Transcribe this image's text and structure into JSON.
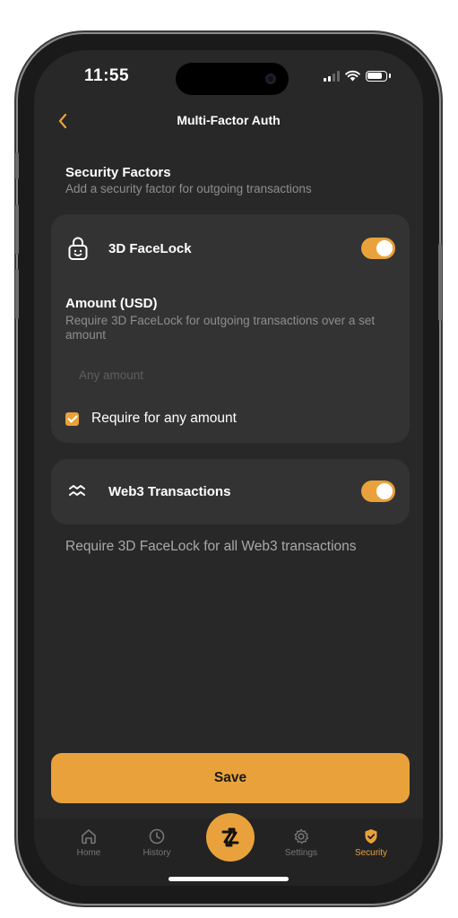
{
  "status_bar": {
    "time": "11:55"
  },
  "header": {
    "back_icon": "chevron-left-icon",
    "title": "Multi-Factor Auth"
  },
  "security_factors": {
    "title": "Security Factors",
    "subtitle": "Add a security factor for outgoing transactions"
  },
  "facelock": {
    "icon": "face-lock-icon",
    "title": "3D FaceLock",
    "enabled": true,
    "amount_title": "Amount (USD)",
    "amount_description": "Require 3D FaceLock for outgoing transactions over a set amount",
    "amount_placeholder": "Any amount",
    "amount_value": "",
    "any_amount_label": "Require for any amount",
    "any_amount_checked": true
  },
  "web3": {
    "icon": "web3-wave-icon",
    "title": "Web3 Transactions",
    "enabled": true,
    "note": "Require 3D FaceLock for all Web3 transactions"
  },
  "save_button": {
    "label": "Save"
  },
  "tab_bar": {
    "items": [
      {
        "label": "Home",
        "icon": "home-icon",
        "active": false
      },
      {
        "label": "History",
        "icon": "clock-icon",
        "active": false
      },
      {
        "label": "",
        "icon": "swap-arrows-icon",
        "active": false
      },
      {
        "label": "Settings",
        "icon": "gear-icon",
        "active": false
      },
      {
        "label": "Security",
        "icon": "shield-check-icon",
        "active": true
      }
    ]
  },
  "colors": {
    "accent": "#E9A23B",
    "background": "#282828",
    "card": "#333333"
  }
}
